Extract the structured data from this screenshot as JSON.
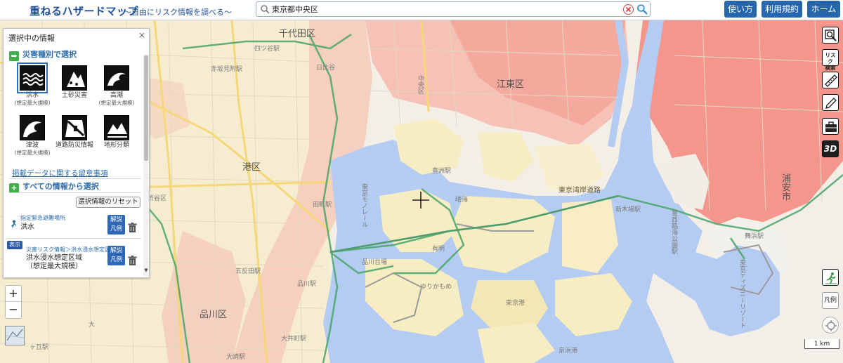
{
  "header": {
    "title": "重ねるハザードマップ",
    "subtitle": "～自由にリスク情報を調べる～",
    "search_value": "東京都中央区",
    "buttons": {
      "howto": "使い方",
      "terms": "利用規約",
      "home": "ホーム"
    }
  },
  "panel": {
    "title": "選択中の情報",
    "close": "×",
    "section_by_type": "災害種別で選択",
    "hazards": [
      {
        "label": "洪水",
        "sub": "(想定最大規模)",
        "icon": "flood-icon",
        "active": true
      },
      {
        "label": "土砂災害",
        "sub": "",
        "icon": "landslide-icon",
        "active": false
      },
      {
        "label": "高潮",
        "sub": "(想定最大規模)",
        "icon": "storm-surge-icon",
        "active": false
      },
      {
        "label": "津波",
        "sub": "(想定最大規模)",
        "icon": "tsunami-icon",
        "active": false
      },
      {
        "label": "道路防災情報",
        "sub": "",
        "icon": "road-disaster-icon",
        "active": false
      },
      {
        "label": "地形分類",
        "sub": "",
        "icon": "terrain-icon",
        "active": false
      }
    ],
    "notes_link": "掲載データに関する留意事項",
    "section_all": "すべての情報から選択",
    "reset_button": "選択情報のリセット",
    "layers": [
      {
        "caption": "指定緊急避難場所",
        "name": "洪水",
        "legend": "解説\n凡例"
      },
      {
        "caption": "災害リスク情報＞洪水浸水想定区",
        "name": "洪水浸水想定区域\n（想定最大規模）",
        "legend": "解説\n凡例",
        "tag": "表示"
      }
    ]
  },
  "zoom": {
    "in": "+",
    "out": "−"
  },
  "tools": {
    "risk_search": "リスク\n検索",
    "three_d": "3D",
    "legend": "凡例"
  },
  "scale": "1 km",
  "map_labels": [
    {
      "text": "千代田区",
      "cls": "big"
    },
    {
      "text": "港区",
      "cls": "big"
    },
    {
      "text": "江東区",
      "cls": "big"
    },
    {
      "text": "浦安市",
      "cls": "big"
    },
    {
      "text": "品川区",
      "cls": "big"
    },
    {
      "text": "東京湾岸道路",
      "cls": "road"
    },
    {
      "text": "四ツ谷駅",
      "cls": "small"
    },
    {
      "text": "赤坂見附駅",
      "cls": "small"
    },
    {
      "text": "日比谷",
      "cls": "small"
    },
    {
      "text": "田町駅",
      "cls": "small"
    },
    {
      "text": "品川駅",
      "cls": "small"
    },
    {
      "text": "五反田駅",
      "cls": "small"
    },
    {
      "text": "大崎駅",
      "cls": "small"
    },
    {
      "text": "大井町駅",
      "cls": "small"
    },
    {
      "text": "品川台場",
      "cls": "small"
    },
    {
      "text": "豊洲駅",
      "cls": "small"
    },
    {
      "text": "有明",
      "cls": "small"
    },
    {
      "text": "新木場駅",
      "cls": "small"
    },
    {
      "text": "葛西臨海公園駅",
      "cls": "small"
    },
    {
      "text": "舞浜駅",
      "cls": "small"
    },
    {
      "text": "東京ディズニーリゾート",
      "cls": "small"
    },
    {
      "text": "東京港",
      "cls": "small"
    },
    {
      "text": "京浜港",
      "cls": "small"
    },
    {
      "text": "晴海",
      "cls": "small"
    },
    {
      "text": "中央区",
      "cls": "small"
    },
    {
      "text": "ゆりかもめ",
      "cls": "small"
    },
    {
      "text": "東京モノレール",
      "cls": "small"
    },
    {
      "text": "大",
      "cls": "small"
    },
    {
      "text": "ヶ丘駅",
      "cls": "small"
    },
    {
      "text": "渋谷区",
      "cls": "small"
    }
  ]
}
